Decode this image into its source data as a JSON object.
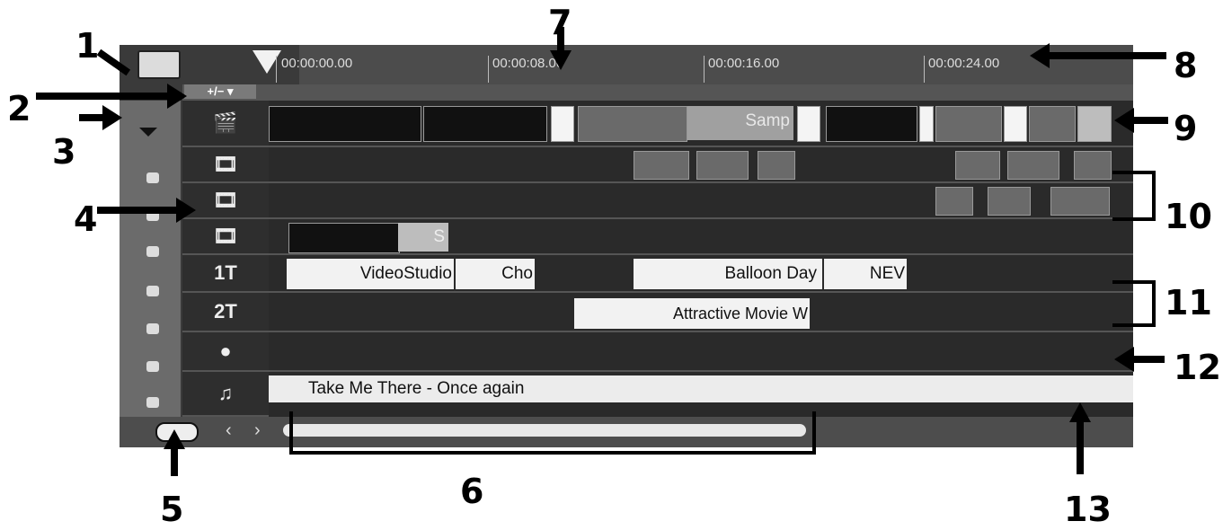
{
  "ruler": {
    "times": [
      "00:00:00.00",
      "00:00:08.00",
      "00:00:16.00",
      "00:00:24.00"
    ]
  },
  "zoom": {
    "label": "+/− ▾"
  },
  "tracks": {
    "title1": {
      "clips": [
        "VideoStudio",
        "Cho",
        "Balloon Day",
        "NEV"
      ]
    },
    "title2": {
      "clips": [
        "Attractive Movie W"
      ]
    },
    "music": {
      "clips": [
        "Take Me There - Once again"
      ]
    },
    "video": {
      "clips": [
        "Samp"
      ]
    },
    "overlay3": {
      "clips": [
        "S"
      ]
    }
  },
  "track_labels": {
    "title1": "1T",
    "title2": "2T",
    "music": "♫"
  },
  "callouts": [
    "1",
    "2",
    "3",
    "4",
    "5",
    "6",
    "7",
    "8",
    "9",
    "10",
    "11",
    "12",
    "13"
  ],
  "icons": [
    "track-manager-icon",
    "video-track-icon",
    "overlay-track-1-icon",
    "overlay-track-2-icon",
    "overlay-track-3-icon",
    "title-track-icon",
    "voice-track-icon",
    "music-track-icon",
    "lock-icon",
    "scroll-left-icon",
    "scroll-right-icon",
    "add-track-icon"
  ]
}
